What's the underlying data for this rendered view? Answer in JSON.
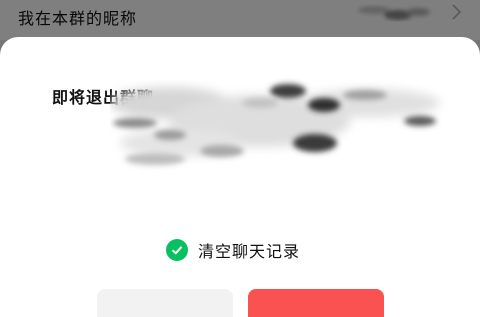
{
  "background": {
    "row_label": "我在本群的昵称",
    "row_value_redacted": true
  },
  "dialog": {
    "title": "即将退出群聊",
    "title_suffix_redacted": true,
    "clear_history": {
      "label": "清空聊天记录",
      "checked": true
    },
    "cancel_label": "",
    "confirm_label": ""
  },
  "colors": {
    "check_green": "#07c160",
    "danger_red": "#fa5151",
    "cancel_gray": "#f2f2f2"
  }
}
